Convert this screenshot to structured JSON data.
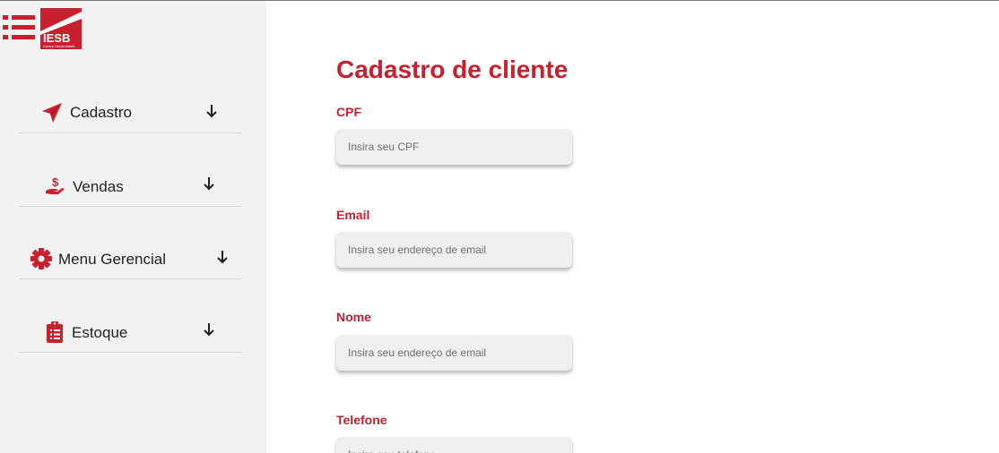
{
  "logo": {
    "text": "IESB",
    "subtext": "Centro Universitário"
  },
  "sidebar": {
    "items": [
      {
        "label": "Cadastro",
        "icon": "paper-plane-icon"
      },
      {
        "label": "Vendas",
        "icon": "hand-dollar-icon"
      },
      {
        "label": "Menu Gerencial",
        "icon": "gear-icon"
      },
      {
        "label": "Estoque",
        "icon": "clipboard-list-icon"
      }
    ]
  },
  "form": {
    "title": "Cadastro de cliente",
    "fields": [
      {
        "label": "CPF",
        "placeholder": "Insira seu CPF"
      },
      {
        "label": "Email",
        "placeholder": "Insira seu endereço de email"
      },
      {
        "label": "Nome",
        "placeholder": "Insira seu endereço de email"
      },
      {
        "label": "Telefone",
        "placeholder": "Insira seu telefone"
      }
    ]
  },
  "colors": {
    "accent": "#c8202e",
    "sidebar_bg": "#f2f2f2",
    "input_bg": "#efefef"
  }
}
